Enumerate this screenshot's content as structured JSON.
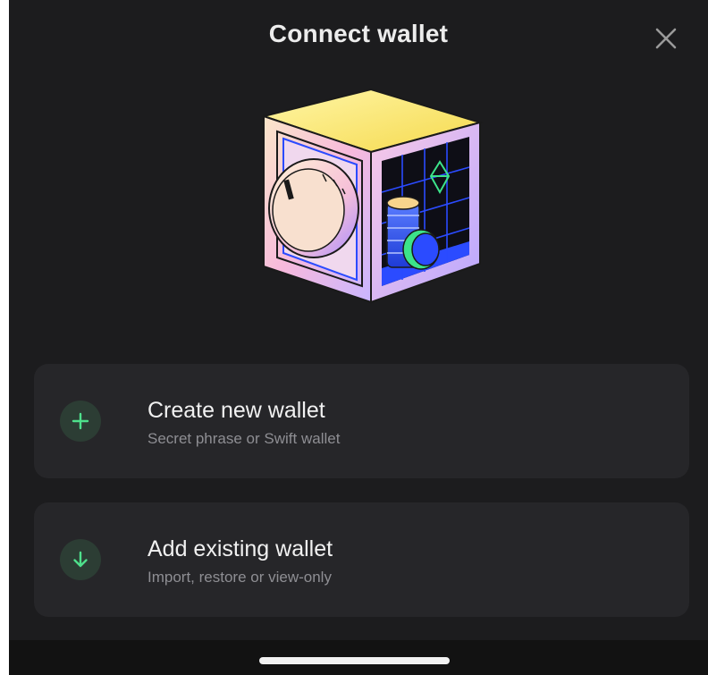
{
  "header": {
    "title": "Connect wallet",
    "close_icon": "close-icon"
  },
  "hero": {
    "icon": "vault-safe-illustration",
    "accent_colors": [
      "#f8e57a",
      "#f4b6d6",
      "#2b4bff",
      "#3ce38a",
      "#cdb8ff"
    ]
  },
  "options": [
    {
      "icon": "plus-icon",
      "title": "Create new wallet",
      "subtitle": "Secret phrase or Swift wallet"
    },
    {
      "icon": "arrow-down-icon",
      "title": "Add existing wallet",
      "subtitle": "Import, restore or view-only"
    }
  ],
  "colors": {
    "background": "#1c1c1e",
    "card": "#262629",
    "icon_circle": "#2c3d34",
    "accent_green": "#4ee08b",
    "subtitle_text": "#8e8e93"
  }
}
